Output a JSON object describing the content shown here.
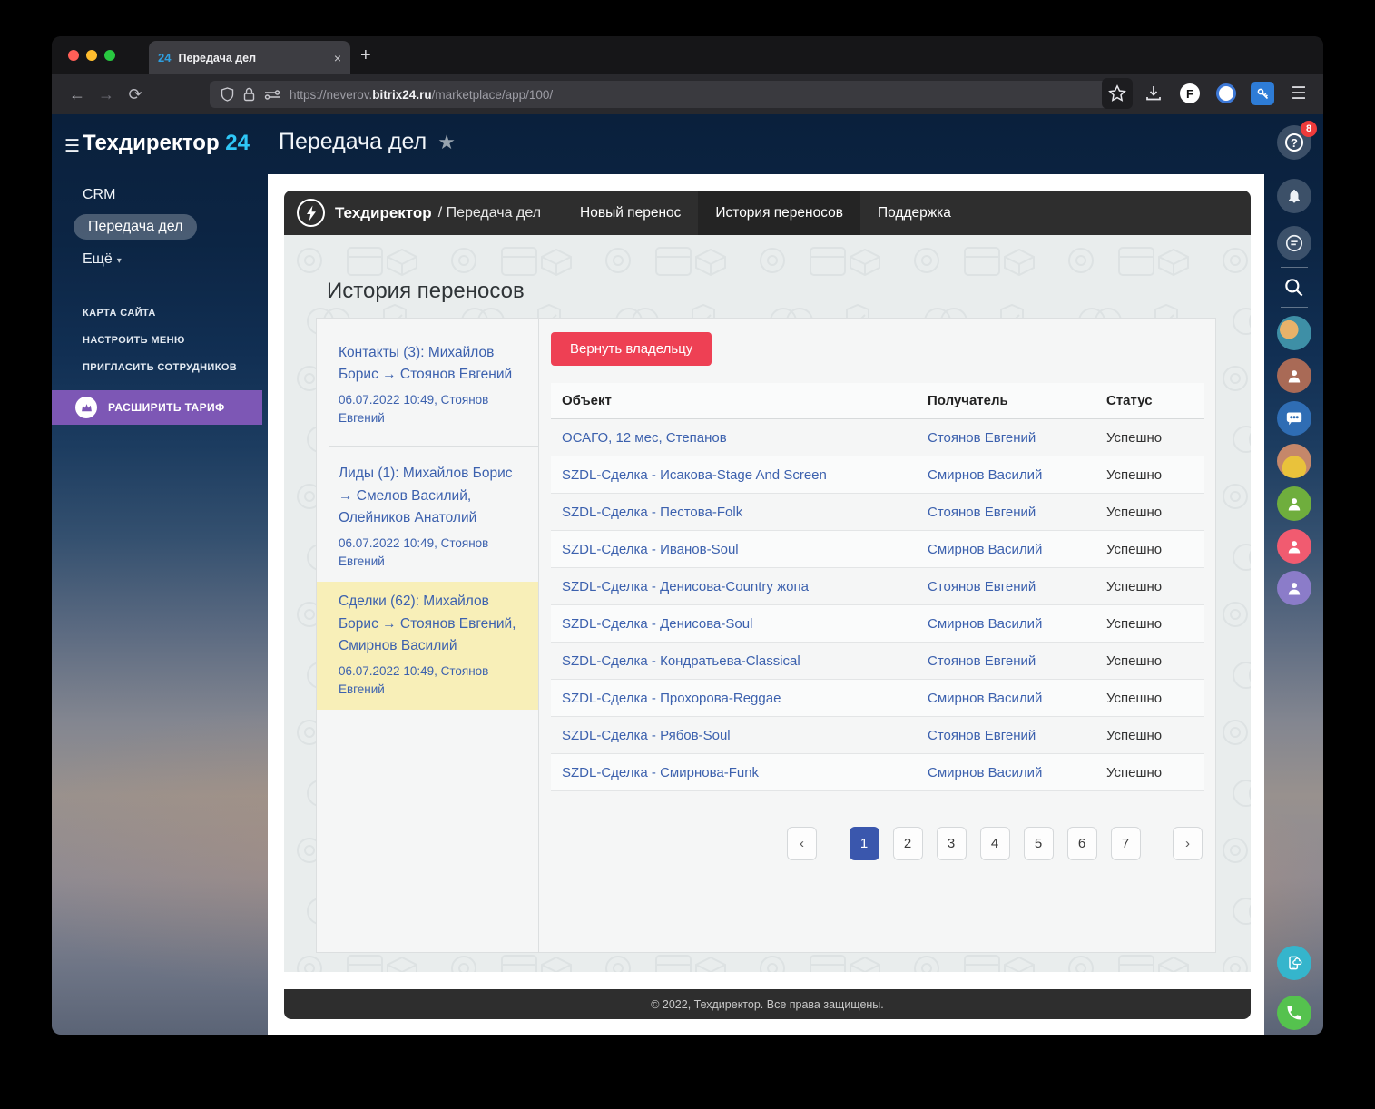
{
  "browser": {
    "tab": {
      "favicon": "24",
      "title": "Передача дел",
      "close": "×",
      "new_tab": "+"
    },
    "url": {
      "prefix": "https://neverov.",
      "domain": "bitrix24.ru",
      "path": "/marketplace/app/100/"
    }
  },
  "portal": {
    "logo": "Техдиректор",
    "logo_suffix": "24",
    "page_title": "Передача дел",
    "sidebar": {
      "item_crm": "CRM",
      "item_active": "Передача дел",
      "item_more": "Ещё",
      "link_sitemap": "КАРТА САЙТА",
      "link_menu": "НАСТРОИТЬ МЕНЮ",
      "link_invite": "ПРИГЛАСИТЬ СОТРУДНИКОВ",
      "tariff": "РАСШИРИТЬ ТАРИФ"
    },
    "help_badge": "8",
    "help_mark": "?"
  },
  "app": {
    "nav": {
      "brand": "Техдиректор",
      "breadcrumb": "/ Передача дел",
      "item_new": "Новый перенос",
      "item_history": "История переносов",
      "item_support": "Поддержка"
    },
    "heading": "История переносов",
    "history": [
      {
        "title": "Контакты (3): Михайлов Борис → Стоянов Евгений",
        "meta": "06.07.2022 10:49, Стоянов Евгений"
      },
      {
        "title": "Лиды (1): Михайлов Борис → Смелов Василий, Олейников Анатолий",
        "meta": "06.07.2022 10:49, Стоянов Евгений"
      },
      {
        "title": "Сделки (62): Михайлов Борис → Стоянов Евгений, Смирнов Василий",
        "meta": "06.07.2022 10:49, Стоянов Евгений"
      }
    ],
    "return_button": "Вернуть владельцу",
    "table": {
      "headers": [
        "Объект",
        "Получатель",
        "Статус"
      ],
      "rows": [
        [
          "ОСАГО, 12 мес, Степанов",
          "Стоянов Евгений",
          "Успешно"
        ],
        [
          "SZDL-Сделка - Исакова-Stage And Screen",
          "Смирнов Василий",
          "Успешно"
        ],
        [
          "SZDL-Сделка - Пестова-Folk",
          "Стоянов Евгений",
          "Успешно"
        ],
        [
          "SZDL-Сделка - Иванов-Soul",
          "Смирнов Василий",
          "Успешно"
        ],
        [
          "SZDL-Сделка - Денисова-Country жопа",
          "Стоянов Евгений",
          "Успешно"
        ],
        [
          "SZDL-Сделка - Денисова-Soul",
          "Смирнов Василий",
          "Успешно"
        ],
        [
          "SZDL-Сделка - Кондратьева-Classical",
          "Стоянов Евгений",
          "Успешно"
        ],
        [
          "SZDL-Сделка - Прохорова-Reggae",
          "Смирнов Василий",
          "Успешно"
        ],
        [
          "SZDL-Сделка - Рябов-Soul",
          "Стоянов Евгений",
          "Успешно"
        ],
        [
          "SZDL-Сделка - Смирнова-Funk",
          "Смирнов Василий",
          "Успешно"
        ]
      ]
    },
    "pagination": {
      "prev": "‹",
      "pages": [
        "1",
        "2",
        "3",
        "4",
        "5",
        "6",
        "7"
      ],
      "active_page": "1",
      "next": "›"
    },
    "footer": "© 2022, Техдиректор. Все права защищены."
  },
  "colors": {
    "accent_blue_link": "#3c61ae",
    "button_red": "#ee4054",
    "selected_yellow": "#f8efb8",
    "pagination_active": "#3a57ad",
    "tariff_purple": "#7d57b5",
    "logo_cyan": "#2fc7f7",
    "badge_red": "#ef3b3b"
  }
}
